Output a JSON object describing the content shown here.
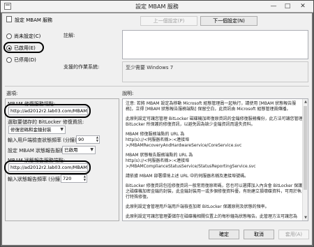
{
  "window": {
    "title": "設定 MBAM 服務",
    "minimize": "—",
    "maximize": "□",
    "close": "✕"
  },
  "header": {
    "setting_name": "設定 MBAM 服務",
    "prev_button": "上一個設定(P)",
    "next_button": "下一個設定(N)"
  },
  "state": {
    "options": [
      {
        "label": "尚未設定(C)",
        "checked": false
      },
      {
        "label": "已啟用(E)",
        "checked": true
      },
      {
        "label": "已停用(D)",
        "checked": false
      }
    ]
  },
  "comment": {
    "label": "註解:"
  },
  "supported": {
    "label": "支援的作業系統:",
    "value": "至少需要 Windows 7"
  },
  "options_panel": {
    "section_label": "選項:",
    "recovery_url_label": "MBAM 修復服務端點:",
    "recovery_url_value": "http://ad2012r2.lab03.com/MBAMRe",
    "recovery_info_label": "選取要儲存的 BitLocker 修復資訊:",
    "recovery_info_value": "修復密碼和金鑰封裝",
    "recovery_freq_label": "輸入用戶端檢查狀態頻率 (分鐘):",
    "recovery_freq_value": "90",
    "status_label": "設定 MBAM 狀態報告服務:",
    "status_value": "已啟用",
    "status_url_label": "MBAM 狀態報告服務端點:",
    "status_url_value": "http://ad2012r2.lab03.com/MBAMCo",
    "status_freq_label": "輸入狀態報告頻率 (分鐘):",
    "status_freq_value": "720"
  },
  "help": {
    "section_label": "說明:",
    "p1": "注意: 若將 MBAM 設定為移動 Microsoft 組態管理員一起執行，請使用 [MBAM 狀態報告服務]，立得 [MBAM 狀態報告服務端點] 保留空白，此資訊由 Microsoft 組態管理員傳播。",
    "p2": "此原則設定可讓您管理 BitLocker 磁碟機加密復原資訊的金鑰修復服務備份，此方法可讓您管理 BitLocker 所保護的修復資訊，以避免因為缺少金鑰資訊而遺失資料。",
    "p3a": "MBAM 修復服務端點的 URL 為",
    "p3b": "http(s)://<伺服器名稱>:<連接埠>/MBAMRecoveryAndHardwareService/CoreService.svc",
    "p4a": "MBAM 狀態報告服務端點的 URL 為",
    "p4b": "http(s)://<伺服器名稱>:<連接埠>/MBAMComplianceStatusService/StatusReportingService.svc",
    "p5": "請依據 MBAM 部署環境上述 URL 中的伺服器名稱及連接埠號碼。",
    "p6": "BitLocker 修復資訊包括修復資訊一般常用復原密碼，您也可以選擇加入內含會 BitLocker 保護之磁碟機加密金鑰的封裝，此金鑰封裝用一或多個修復資料優，有助建立損壞碟資料，可用於執行特殊修復。",
    "p7": "此原則設定會管理用戶端用戶端檢查加密 BitLocker 保護原則及狀態的頻率。",
    "p8": "此原則設定可讓您管理要儲存在磁碟機相關位置上的每秒鐘為狀態報告。此管理方法可讓您為"
  },
  "footer": {
    "ok": "確定",
    "cancel": "取消",
    "apply": "套用(A)"
  }
}
